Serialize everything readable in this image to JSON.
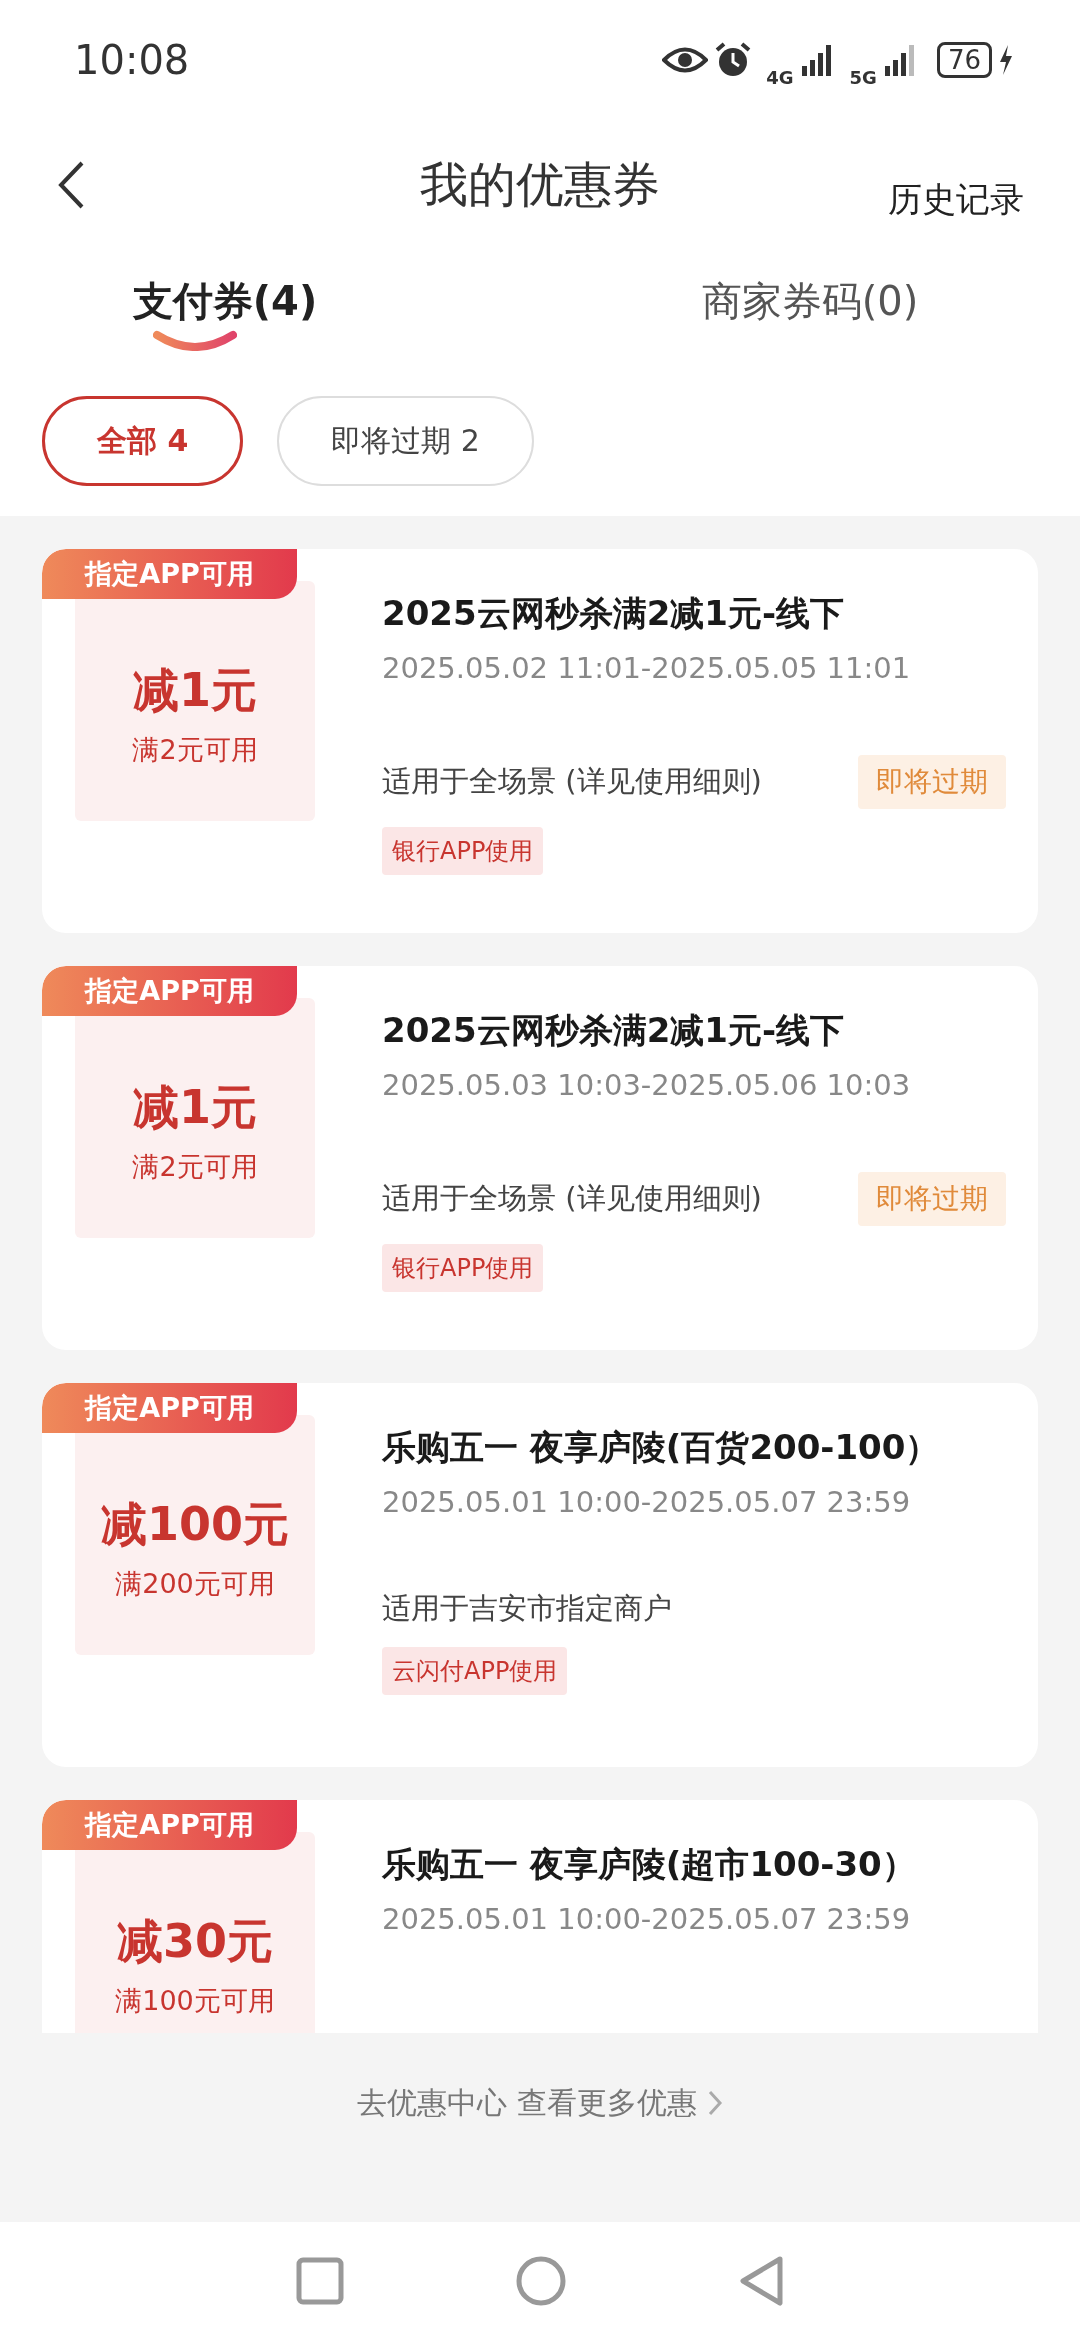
{
  "status_bar": {
    "time": "10:08",
    "network_1": "4G",
    "network_2": "5G",
    "battery": "76"
  },
  "header": {
    "title": "我的优惠券",
    "action": "历史记录"
  },
  "tabs": [
    {
      "label": "支付券(4)",
      "selected": true
    },
    {
      "label": "商家券码(0)",
      "selected": false
    }
  ],
  "filters": [
    {
      "label": "全部 4",
      "selected": true
    },
    {
      "label": "即将过期 2",
      "selected": false
    }
  ],
  "coupons": [
    {
      "ribbon": "指定APP可用",
      "amount": "减1元",
      "condition": "满2元可用",
      "title": "2025云网秒杀满2减1元-线下",
      "period": "2025.05.02 11:01-2025.05.05 11:01",
      "scope": "适用于全场景 (详见使用细则)",
      "badge": "即将过期",
      "tag": "银行APP使用"
    },
    {
      "ribbon": "指定APP可用",
      "amount": "减1元",
      "condition": "满2元可用",
      "title": "2025云网秒杀满2减1元-线下",
      "period": "2025.05.03 10:03-2025.05.06 10:03",
      "scope": "适用于全场景 (详见使用细则)",
      "badge": "即将过期",
      "tag": "银行APP使用"
    },
    {
      "ribbon": "指定APP可用",
      "amount": "减100元",
      "condition": "满200元可用",
      "title": "乐购五一 夜享庐陵(百货200-100）",
      "period": "2025.05.01 10:00-2025.05.07 23:59",
      "scope": "适用于吉安市指定商户",
      "tag": "云闪付APP使用"
    },
    {
      "ribbon": "指定APP可用",
      "amount": "减30元",
      "condition": "满100元可用",
      "title": "乐购五一 夜享庐陵(超市100-30）",
      "period": "2025.05.01 10:00-2025.05.07 23:59"
    }
  ],
  "footer_link": "去优惠中心 查看更多优惠"
}
